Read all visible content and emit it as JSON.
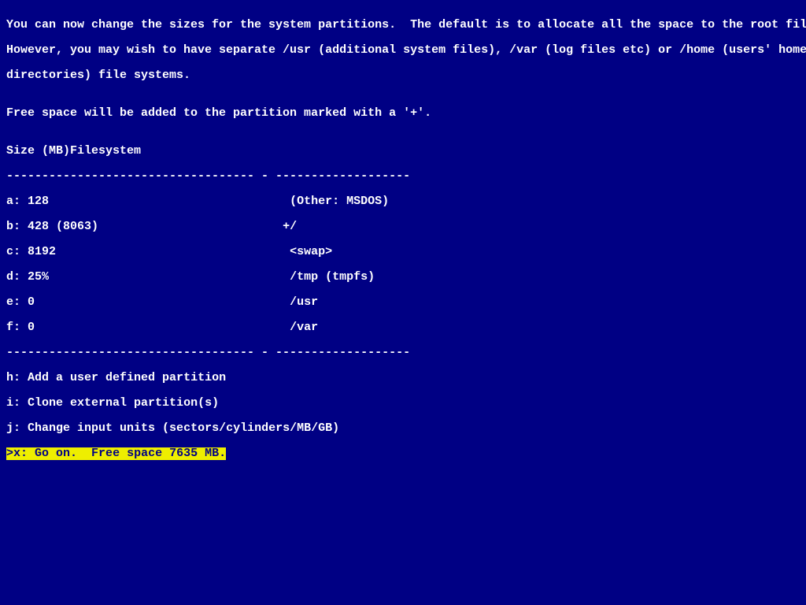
{
  "intro": {
    "line1": "You can now change the sizes for the system partitions.  The default is to allocate all the space to the root file system.",
    "line2": "However, you may wish to have separate /usr (additional system files), /var (log files etc) or /home (users' home",
    "line3": "directories) file systems.",
    "line4": "Free space will be added to the partition marked with a '+'."
  },
  "headers": {
    "size": "Size (MB)",
    "filesystem": "Filesystem"
  },
  "separator": "----------------------------------- - -------------------",
  "partitions": [
    {
      "key": "a",
      "size": "128",
      "mark": " ",
      "fs": "(Other: MSDOS)"
    },
    {
      "key": "b",
      "size": "428 (8063)",
      "mark": "+",
      "fs": "/"
    },
    {
      "key": "c",
      "size": "8192",
      "mark": " ",
      "fs": "<swap>"
    },
    {
      "key": "d",
      "size": "25%",
      "mark": " ",
      "fs": "/tmp (tmpfs)"
    },
    {
      "key": "e",
      "size": "0",
      "mark": " ",
      "fs": "/usr"
    },
    {
      "key": "f",
      "size": "0",
      "mark": " ",
      "fs": "/var"
    }
  ],
  "actions": [
    {
      "key": "h",
      "label": "Add a user defined partition"
    },
    {
      "key": "i",
      "label": "Clone external partition(s)"
    },
    {
      "key": "j",
      "label": "Change input units (sectors/cylinders/MB/GB)"
    }
  ],
  "selected": {
    "key": "x",
    "label": "Go on.  Free space 7635 MB."
  }
}
